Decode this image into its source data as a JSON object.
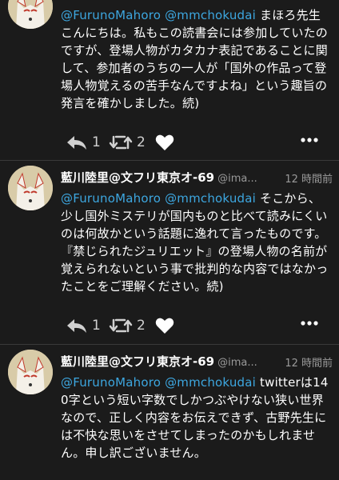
{
  "tweets": [
    {
      "name": "",
      "handle": "",
      "time": "",
      "mentions": "@FurunoMahoro @mmchokudai",
      "text": " まほろ先生こんにちは。私もこの読書会には参加していたのですが、登場人物がカタカナ表記であることに関して、参加者のうちの一人が「国外の作品って登場人物覚えるの苦手なんですよね」という趣旨の発言を確かしました。続)",
      "reply_count": "1",
      "retweet_count": "2"
    },
    {
      "name": "藍川陸里@文フリ東京オ-69",
      "handle": "@ima...",
      "time": "12 時間前",
      "mentions": "@FurunoMahoro @mmchokudai",
      "text": " そこから、少し国外ミステリが国内ものと比べて読みにくいのは何故かという話題に逸れて言ったものです。『禁じられたジュリエット』の登場人物の名前が覚えられないという事で批判的な内容ではなかったことをご理解ください。続)",
      "reply_count": "1",
      "retweet_count": "2"
    },
    {
      "name": "藍川陸里@文フリ東京オ-69",
      "handle": "@ima...",
      "time": "12 時間前",
      "mentions": "@FurunoMahoro @mmchokudai",
      "text": " twitterは140字という短い字数でしかつぶやけない狭い世界なので、正しく内容をお伝えできず、古野先生には不快な思いをさせてしまったのかもしれません。申し訳ございません。",
      "reply_count": "",
      "retweet_count": ""
    }
  ],
  "icons": {
    "reply": "reply-arrow-icon",
    "retweet": "retweet-icon",
    "like": "heart-icon",
    "more": "more-dots-icon"
  },
  "colors": {
    "background": "#1b1b1b",
    "mention": "#3da7e0",
    "secondary_text": "#9a9a9a"
  }
}
